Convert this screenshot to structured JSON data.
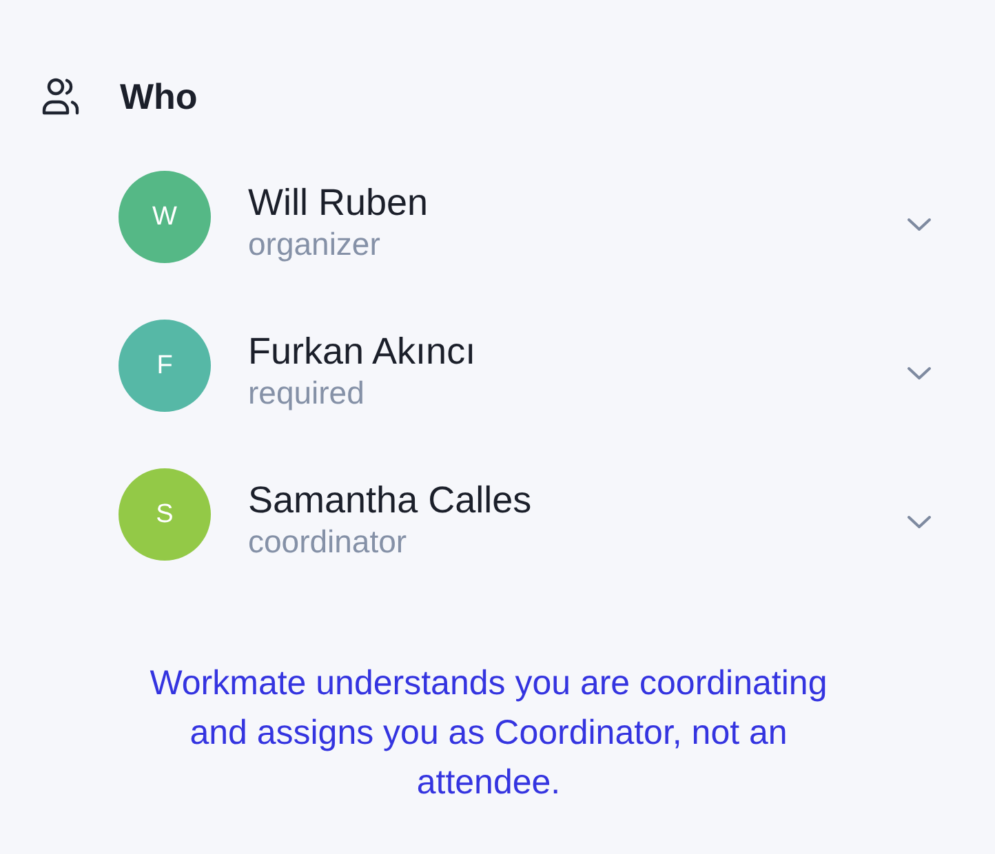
{
  "who": {
    "title": "Who",
    "attendees": [
      {
        "initial": "W",
        "name": "Will Ruben",
        "role": "organizer",
        "color": "#55b886"
      },
      {
        "initial": "F",
        "name": "Furkan Akıncı",
        "role": "required",
        "color": "#56b8a6"
      },
      {
        "initial": "S",
        "name": "Samantha Calles",
        "role": "coordinator",
        "color": "#93c947"
      }
    ]
  },
  "note": "Workmate understands you are coordinating and assigns you as Coordinator, not an attendee."
}
